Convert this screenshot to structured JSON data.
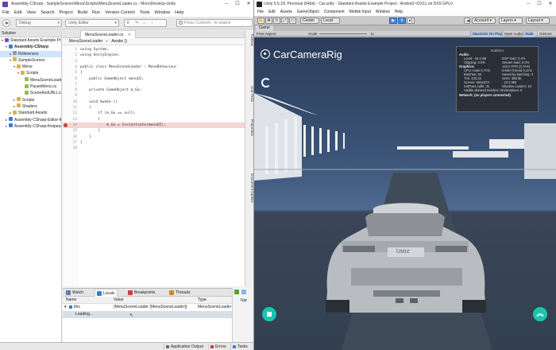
{
  "monodevelop": {
    "title": "Assembly-CSharp - SampleScenes\\Menu\\Scripts\\MenuSceneLoader.cs - MonoDevelop-Unity",
    "menu": [
      "File",
      "Edit",
      "View",
      "Search",
      "Project",
      "Build",
      "Run",
      "Version Control",
      "Tools",
      "Window",
      "Help"
    ],
    "toolbar": {
      "config": "Debug",
      "target": "Unity Editor",
      "search_placeholder": "Press 'Control+,' to search"
    },
    "solution": {
      "header": "Solution",
      "items": [
        {
          "label": "Standard Assets Example Proje",
          "type": "sln",
          "indent": 0,
          "arrow": "▾",
          "sel": false
        },
        {
          "label": "Assembly-CSharp",
          "type": "proj",
          "indent": 1,
          "arrow": "▾",
          "sel": false
        },
        {
          "label": "References",
          "type": "ref",
          "indent": 2,
          "arrow": "▸",
          "sel": true
        },
        {
          "label": "SampleScenes",
          "type": "fold",
          "indent": 2,
          "arrow": "▾",
          "sel": false
        },
        {
          "label": "Menu",
          "type": "fold",
          "indent": 3,
          "arrow": "▾",
          "sel": false
        },
        {
          "label": "Scripts",
          "type": "fold",
          "indent": 4,
          "arrow": "▾",
          "sel": false
        },
        {
          "label": "MenuSceneLoader",
          "type": "cs",
          "indent": 5,
          "arrow": "",
          "sel": false
        },
        {
          "label": "PauseMenu.cs",
          "type": "cs",
          "indent": 5,
          "arrow": "",
          "sel": false
        },
        {
          "label": "SceneAndURLLoad",
          "type": "cs",
          "indent": 5,
          "arrow": "",
          "sel": false
        },
        {
          "label": "Scripts",
          "type": "fold",
          "indent": 3,
          "arrow": "▸",
          "sel": false
        },
        {
          "label": "Shaders",
          "type": "fold",
          "indent": 3,
          "arrow": "▸",
          "sel": false
        },
        {
          "label": "Standard Assets",
          "type": "fold",
          "indent": 2,
          "arrow": "▸",
          "sel": false
        },
        {
          "label": "Assembly-CSharp-Editor-fir",
          "type": "proj",
          "indent": 1,
          "arrow": "▸",
          "sel": false
        },
        {
          "label": "Assembly-CSharp-firstpass",
          "type": "proj",
          "indent": 1,
          "arrow": "▸",
          "sel": false
        }
      ]
    },
    "editor": {
      "tab": "MenuSceneLoader.cs",
      "crumb_class": "MenuSceneLoader",
      "crumb_method": "Awake ()",
      "lines": [
        {
          "n": "1",
          "code": "using System;"
        },
        {
          "n": "2",
          "code": "using UnityEngine;"
        },
        {
          "n": "3",
          "code": ""
        },
        {
          "n": "4",
          "code": "public class MenuSceneLoader : MonoBehaviour"
        },
        {
          "n": "5",
          "code": "{"
        },
        {
          "n": "6",
          "code": "    public GameObject menuUI;"
        },
        {
          "n": "7",
          "code": ""
        },
        {
          "n": "8",
          "code": "    private GameObject m_Go;"
        },
        {
          "n": "9",
          "code": ""
        },
        {
          "n": "10",
          "code": "    void Awake ()"
        },
        {
          "n": "11",
          "code": "    {"
        },
        {
          "n": "12",
          "code": "        if (m_Go == null)"
        },
        {
          "n": "13",
          "code": "        {"
        },
        {
          "n": "14",
          "code": "            m_Go = Instantiate(menuUI);"
        },
        {
          "n": "15",
          "code": "        }"
        },
        {
          "n": "16",
          "code": "    }"
        },
        {
          "n": "17",
          "code": "}"
        },
        {
          "n": "18",
          "code": ""
        }
      ],
      "breakpoint_line": "14"
    },
    "debug": {
      "tabs": [
        "Watch",
        "Locals",
        "Breakpoints",
        "Threads"
      ],
      "active_tab": "Locals",
      "columns": [
        "Name",
        "Value",
        "Type"
      ],
      "row": {
        "name": "this",
        "value": "{MenuSceneLoader (MenuSceneLoader)}",
        "type": "MenuSceneLoader"
      },
      "loading": "Loading...",
      "side_label": "Nar"
    },
    "right_pads": [
      "Toolbox",
      "Unit Tests",
      "Properties",
      "Document Outline"
    ],
    "status": [
      "Application Output",
      "Errors",
      "Tasks"
    ]
  },
  "unity": {
    "title": "Unity 5.6.1f1 Personal (64bit) - Car.unity - Standard Assets Example Project - Android <DX11 on DX9 GPU>",
    "menu": [
      "File",
      "Edit",
      "Assets",
      "GameObject",
      "Component",
      "Mobile Input",
      "Window",
      "Help"
    ],
    "toolbar": {
      "center": "Center",
      "local": "Local",
      "account": "Account",
      "layers": "Layers",
      "layout": "Layout"
    },
    "game_tab": "Game",
    "game_bar": {
      "display": "Free Aspect",
      "scale_label": "Scale",
      "scale_value": "1x",
      "buttons": [
        "Maximize On Play",
        "Mute Audio",
        "Stats",
        "Gizmos"
      ]
    },
    "overlay_title": "CarCameraRig",
    "stats": {
      "title": "Statistics",
      "audio_head": "Audio:",
      "audio": [
        {
          "l": "Level: -16.3 dB",
          "r": "DSP load: 0.4%"
        },
        {
          "l": "Clipping: 0.0%",
          "r": "Stream load: 0.0%"
        }
      ],
      "graphics_head": "Graphics:",
      "graphics_fps": "143.0 FPS (3.7ms)",
      "graphics": [
        {
          "l": "CPU: main 6.7ms",
          "r": "render thread 0.1ms"
        },
        {
          "l": "Batches: 54",
          "r": "Saved by batching: 3"
        },
        {
          "l": "Tris: 433.1k",
          "r": "Verts: 390.9k"
        },
        {
          "l": "Screen: 664x673",
          "r": "- 10.5 MB"
        },
        {
          "l": "SetPass calls: 41",
          "r": "Shadow casters: 10"
        },
        {
          "l": "Visible skinned meshes: 0",
          "r": "Animations: 0"
        }
      ],
      "network": "Network: (no players connected)"
    },
    "car_plate": "Ustrz"
  },
  "colors": {
    "accent": "#19c4b0",
    "breakpoint": "#d23c3c",
    "selection": "#cfe3fb"
  }
}
